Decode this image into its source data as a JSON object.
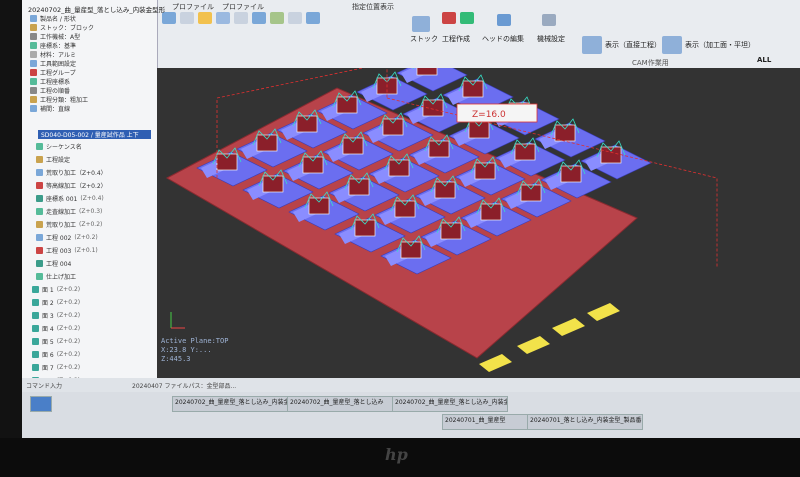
{
  "ribbon": {
    "title": "CAM 編集",
    "groups": [
      "ストック",
      "工程作成",
      "ヘッドの編集",
      "機械設定",
      "CAM作業用"
    ],
    "display_buttons": [
      "表示（直接工程）",
      "表示（加工面・平坦）"
    ],
    "all_label": "ALL",
    "tabs": [
      "プロファイル",
      "プロファイル",
      "指定位置表示"
    ]
  },
  "navigator": {
    "header": "SD040-D05-002 / 量産試作品 上下",
    "top_items": [
      "20240702_曲_量産型_落とし込み_内装金型形",
      "製品名 / 形状",
      "ストック：ブロック",
      "工作機械：A型",
      "座標系：基準",
      "材料：アルミ",
      "工具範囲設定",
      "工程グループ",
      "工程座標系",
      "工程の順番",
      "工程分類：粗加工",
      "補間：直線"
    ],
    "tree_items": [
      "シーケンス名",
      "工程設定",
      "荒取り加工（Z+0.4）",
      "等高線加工（Z+0.2）",
      "座標系 001",
      "走査線加工",
      "荒取り加工",
      "工程 002",
      "工程 003",
      "工程 004",
      "仕上げ加工",
      "面 1",
      "面 2",
      "面 3",
      "面 4",
      "面 5",
      "面 6",
      "面 7",
      "面 8",
      "面 9",
      "面 10"
    ],
    "tree_values": [
      "",
      "",
      "",
      "",
      "(Z+0.4)",
      "(Z+0.3)",
      "(Z+0.2)",
      "(Z+0.2)",
      "(Z+0.1)",
      "",
      "",
      "(Z+0.2)",
      "(Z+0.2)",
      "(Z+0.2)",
      "(Z+0.2)",
      "(Z+0.2)",
      "(Z+0.2)",
      "(Z+0.2)",
      "(Z+0.2)",
      "(Z+0.2)",
      "(Z+0.2)"
    ]
  },
  "viewport": {
    "annotation": "Z=16.0",
    "active_plane": "Active Plane:TOP",
    "coords": "X:23.8 Y:...",
    "coords2": "Z:445.3"
  },
  "status": {
    "left": "コマンド入力",
    "text": "20240407 ファイルパス：金型部品..."
  },
  "taskbar": {
    "items": [
      "20240702_曲_量産型_落とし込み_内装金型形",
      "20240702_曲_量産型_落とし込み",
      "20240702_曲_量産型_落とし込み_内装金型形",
      "20240701_曲_量産型",
      "20240701_落とし込み_内装金型_製品番.gmd"
    ]
  },
  "brand": "hp"
}
